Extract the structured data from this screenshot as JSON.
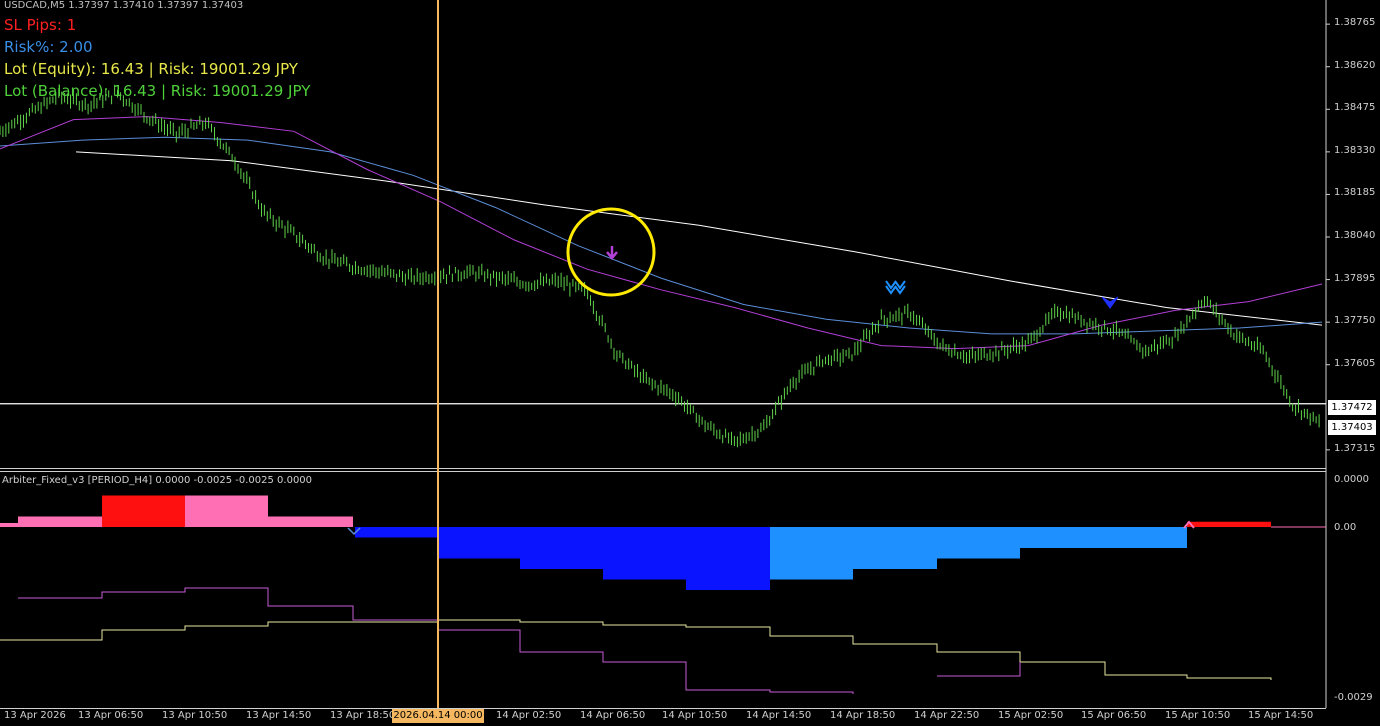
{
  "header": {
    "symbol_line": "USDCAD,M5  1.37397 1.37410 1.37397 1.37403",
    "sl_pips": "SL Pips: 1",
    "risk_pct": "Risk%: 2.00",
    "lot_equity": "Lot (Equity): 16.43  |  Risk: 19001.29 JPY",
    "lot_balance": "Lot (Balance): 16.43  |  Risk: 19001.29 JPY"
  },
  "colors": {
    "price": "#5fd34a",
    "sl_pips": "#ff2020",
    "risk_pct": "#3a8ee6",
    "lot_equity": "#e8e84a",
    "lot_balance": "#4fd13a",
    "ma_white": "#ffffff",
    "ma_blue": "#5b8ed8",
    "ma_purple": "#b23fd6",
    "crosshair": "#f5b860",
    "highlight_circle": "#ffea00",
    "hist_pink": "#ff6fb4",
    "hist_red": "#ff1010",
    "hist_blue": "#0a14ff",
    "hist_lightblue": "#1e90ff"
  },
  "price_axis": {
    "labels": [
      "1.38765",
      "1.38620",
      "1.38475",
      "1.38330",
      "1.38185",
      "1.38040",
      "1.37895",
      "1.37750",
      "1.37605",
      "1.37315"
    ],
    "current_price": "1.37472",
    "last_price": "1.37403"
  },
  "subwindow": {
    "title": "Arbiter_Fixed_v3 [PERIOD_H4] 0.0000 -0.0025 -0.0025 0.0000",
    "axis_top": "0.0000",
    "axis_zero": "0.00",
    "axis_bottom": "-0.0029"
  },
  "time_axis": {
    "labels": [
      "13 Apr 2026",
      "13 Apr 06:50",
      "13 Apr 10:50",
      "13 Apr 14:50",
      "13 Apr 18:50",
      "14 Apr 02:50",
      "14 Apr 06:50",
      "14 Apr 10:50",
      "14 Apr 14:50",
      "14 Apr 18:50",
      "14 Apr 22:50",
      "15 Apr 02:50",
      "15 Apr 06:50",
      "15 Apr 10:50",
      "15 Apr 14:50"
    ],
    "crosshair_label": "2026.04.14 00:00"
  },
  "signals": [
    "down-arrow-purple",
    "double-down-arrow-blue",
    "down-chevron-blue"
  ],
  "chart_data": {
    "type": "line",
    "title": "USDCAD,M5",
    "xlabel": "",
    "ylabel": "",
    "ylim": [
      1.3726,
      1.3882
    ],
    "series": [
      {
        "values": [
          1.384,
          1.3846,
          1.3852,
          1.3849,
          1.3853,
          1.3845,
          1.3839,
          1.3843,
          1.383,
          1.3812,
          1.3805,
          1.3797,
          1.3794,
          1.3792,
          1.379,
          1.3791,
          1.3792,
          1.379,
          1.3788,
          1.3789,
          1.3785,
          1.3764,
          1.3755,
          1.375,
          1.374,
          1.3734,
          1.3739,
          1.3755,
          1.3762,
          1.3764,
          1.3776,
          1.3778,
          1.3767,
          1.3763,
          1.3765,
          1.3768,
          1.3779,
          1.3775,
          1.3772,
          1.3765,
          1.377,
          1.3783,
          1.3771,
          1.3765,
          1.3747,
          1.374
        ]
      },
      {
        "values": [
          1.3834,
          1.3844,
          1.3845,
          1.3843,
          1.384,
          1.3827,
          1.3816,
          1.3803,
          1.3793,
          1.3786,
          1.378,
          1.3773,
          1.3767,
          1.3766,
          1.3767,
          1.3774,
          1.3779,
          1.3782,
          1.3788
        ]
      },
      {
        "values": [
          1.3835,
          1.3837,
          1.3838,
          1.3837,
          1.3833,
          1.3825,
          1.3814,
          1.3801,
          1.379,
          1.3781,
          1.3776,
          1.3773,
          1.3771,
          1.3771,
          1.3772,
          1.3773,
          1.3775
        ]
      },
      {
        "values": [
          1.3833,
          1.383,
          1.3823,
          1.3815,
          1.3808,
          1.3799,
          1.3789,
          1.378,
          1.3774
        ]
      }
    ]
  },
  "indicator_data": {
    "type": "bar",
    "histogram": [
      {
        "color": "pink",
        "value": 0.0
      },
      {
        "color": "pink",
        "value": 0.0001
      },
      {
        "color": "red",
        "value": 0.0003
      },
      {
        "color": "pink",
        "value": 0.0003
      },
      {
        "color": "pink",
        "value": 0.0001
      },
      {
        "color": "blue",
        "value": -0.0001
      },
      {
        "color": "blue",
        "value": -0.0003
      },
      {
        "color": "blue",
        "value": -0.0004
      },
      {
        "color": "blue",
        "value": -0.0005
      },
      {
        "color": "blue",
        "value": -0.0006
      },
      {
        "color": "lightblue",
        "value": -0.0005
      },
      {
        "color": "lightblue",
        "value": -0.0004
      },
      {
        "color": "lightblue",
        "value": -0.0003
      },
      {
        "color": "lightblue",
        "value": -0.0002
      },
      {
        "color": "red",
        "value": 5e-05
      }
    ]
  }
}
